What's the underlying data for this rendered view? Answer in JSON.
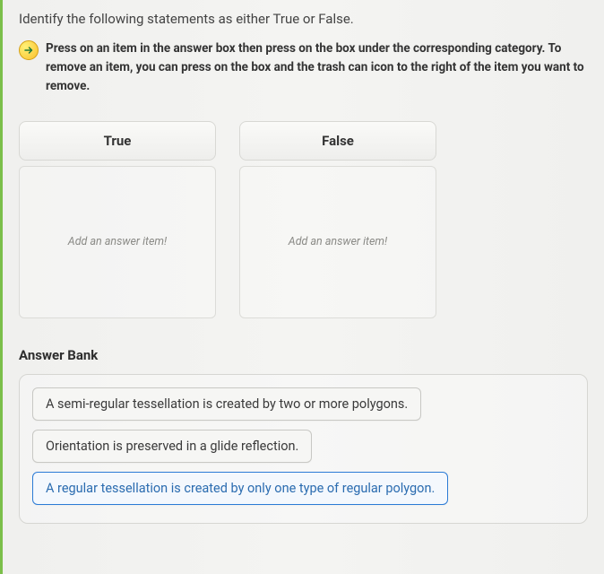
{
  "question": {
    "prompt": "Identify the following statements as either True or False.",
    "instructions": "Press on an item in the answer box then press on the box under the corresponding category. To remove an item, you can press on the box and the trash can icon to the right of the item you want to remove."
  },
  "categories": [
    {
      "label": "True",
      "placeholder": "Add an answer item!"
    },
    {
      "label": "False",
      "placeholder": "Add an answer item!"
    }
  ],
  "answer_bank": {
    "title": "Answer Bank",
    "items": [
      {
        "text": "A semi-regular tessellation is created by two or more polygons.",
        "selected": false
      },
      {
        "text": "Orientation is preserved in a glide reflection.",
        "selected": false
      },
      {
        "text": "A regular tessellation is created by only one type of regular polygon.",
        "selected": true
      }
    ]
  }
}
